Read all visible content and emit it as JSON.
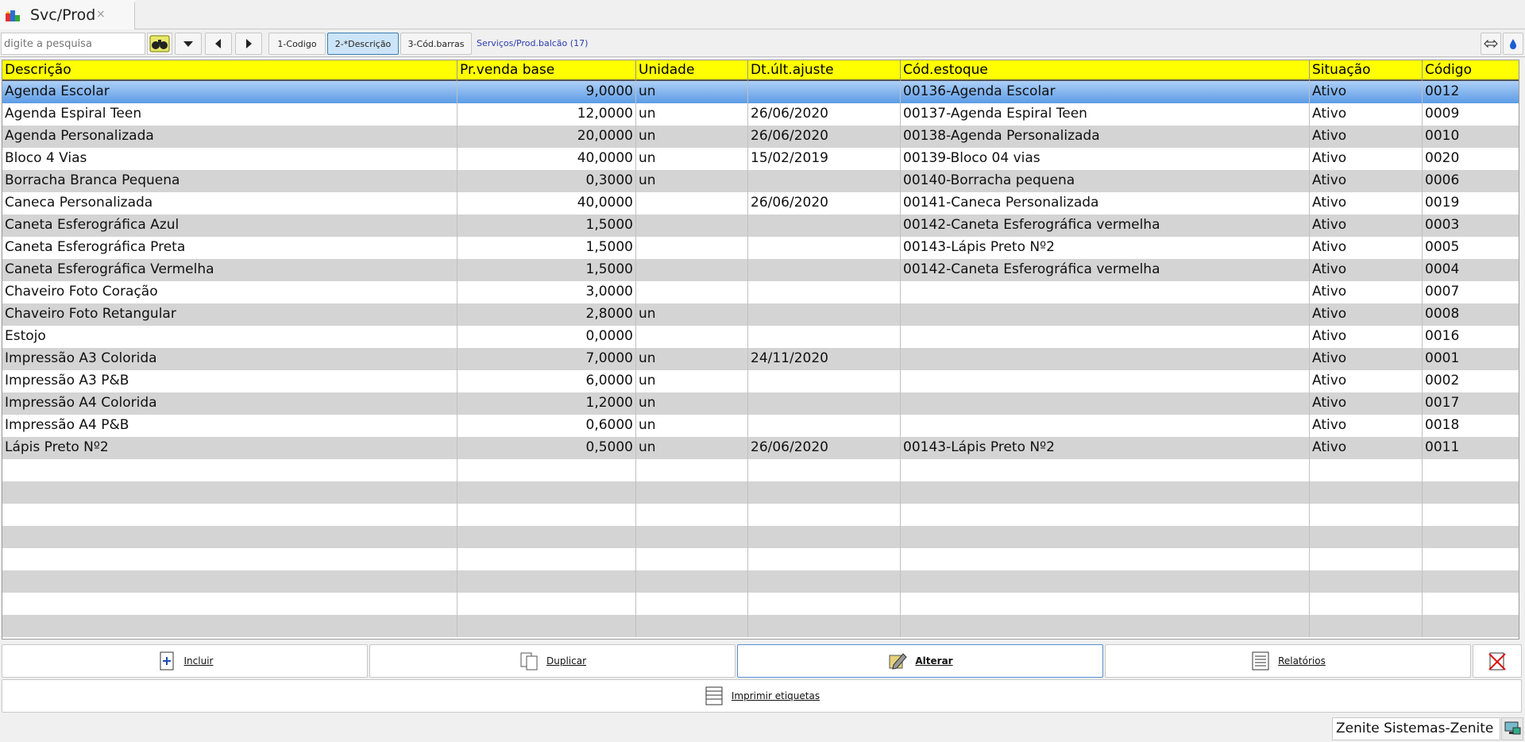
{
  "tab": {
    "title": "Svc/Prod",
    "close": "×"
  },
  "toolbar": {
    "search_placeholder": "digite a pesquisa",
    "sort_buttons": [
      "1-Codigo",
      "2-*Descrição",
      "3-Cód.barras"
    ],
    "active_sort": "2-*Descrição",
    "breadcrumb": "Serviços/Prod.balcão (17)"
  },
  "grid": {
    "columns": [
      "Descrição",
      "Pr.venda base",
      "Unidade",
      "Dt.últ.ajuste",
      "Cód.estoque",
      "Situação",
      "Código"
    ],
    "rows": [
      [
        "Agenda Escolar",
        "9,0000",
        "un",
        "",
        "00136-Agenda Escolar",
        "Ativo",
        "0012"
      ],
      [
        "Agenda Espiral Teen",
        "12,0000",
        "un",
        "26/06/2020",
        "00137-Agenda Espiral Teen",
        "Ativo",
        "0009"
      ],
      [
        "Agenda Personalizada",
        "20,0000",
        "un",
        "26/06/2020",
        "00138-Agenda Personalizada",
        "Ativo",
        "0010"
      ],
      [
        "Bloco 4 Vias",
        "40,0000",
        "un",
        "15/02/2019",
        "00139-Bloco 04 vias",
        "Ativo",
        "0020"
      ],
      [
        "Borracha Branca Pequena",
        "0,3000",
        "un",
        "",
        "00140-Borracha pequena",
        "Ativo",
        "0006"
      ],
      [
        "Caneca Personalizada",
        "40,0000",
        "",
        "26/06/2020",
        "00141-Caneca Personalizada",
        "Ativo",
        "0019"
      ],
      [
        "Caneta Esferográfica Azul",
        "1,5000",
        "",
        "",
        "00142-Caneta Esferográfica vermelha",
        "Ativo",
        "0003"
      ],
      [
        "Caneta Esferográfica Preta",
        "1,5000",
        "",
        "",
        "00143-Lápis Preto Nº2",
        "Ativo",
        "0005"
      ],
      [
        "Caneta Esferográfica Vermelha",
        "1,5000",
        "",
        "",
        "00142-Caneta Esferográfica vermelha",
        "Ativo",
        "0004"
      ],
      [
        "Chaveiro Foto Coração",
        "3,0000",
        "",
        "",
        "",
        "Ativo",
        "0007"
      ],
      [
        "Chaveiro Foto Retangular",
        "2,8000",
        "un",
        "",
        "",
        "Ativo",
        "0008"
      ],
      [
        "Estojo",
        "0,0000",
        "",
        "",
        "",
        "Ativo",
        "0016"
      ],
      [
        "Impressão A3 Colorida",
        "7,0000",
        "un",
        "24/11/2020",
        "",
        "Ativo",
        "0001"
      ],
      [
        "Impressão A3 P&B",
        "6,0000",
        "un",
        "",
        "",
        "Ativo",
        "0002"
      ],
      [
        "Impressão A4 Colorida",
        "1,2000",
        "un",
        "",
        "",
        "Ativo",
        "0017"
      ],
      [
        "Impressão A4 P&B",
        "0,6000",
        "un",
        "",
        "",
        "Ativo",
        "0018"
      ],
      [
        "Lápis Preto Nº2",
        "0,5000",
        "un",
        "26/06/2020",
        "00143-Lápis Preto Nº2",
        "Ativo",
        "0011"
      ]
    ],
    "selected_row": 0
  },
  "actions": {
    "incluir": "Incluir",
    "duplicar": "Duplicar",
    "alterar": "Alterar",
    "relatorios": "Relatórios",
    "imprimir": "Imprimir etiquetas"
  },
  "status": {
    "text": "Zenite Sistemas-Zenite"
  },
  "colors": {
    "header": "#ffff00",
    "selected": "#5c9be6",
    "alt_row": "#d4d4d4",
    "link": "#2a3db0"
  }
}
